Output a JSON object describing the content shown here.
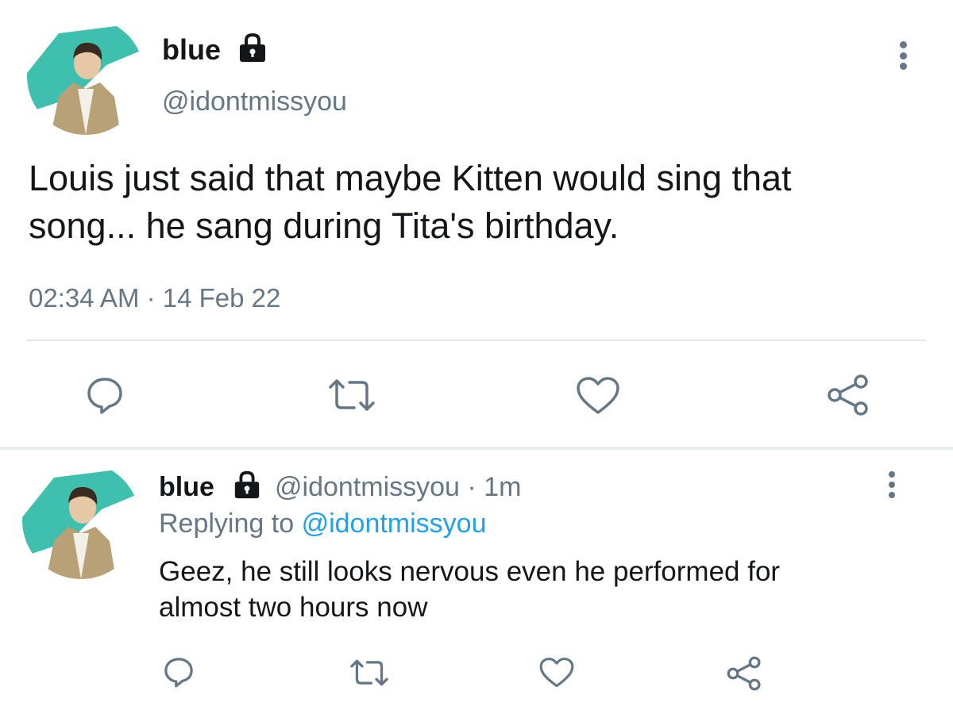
{
  "main_tweet": {
    "display_name": "blue",
    "handle": "@idontmissyou",
    "text_line1": "Louis just said that maybe Kitten would sing that",
    "text_line2": "song... he sang during Tita's birthday.",
    "timestamp": "02:34 AM · 14 Feb 22",
    "actions": [
      "reply-icon",
      "retweet-icon",
      "like-icon",
      "share-icon"
    ]
  },
  "reply_tweet": {
    "display_name": "blue",
    "handle": "@idontmissyou",
    "time": "· 1m",
    "replying_prefix": "Replying to",
    "replying_to": "@idontmissyou",
    "text_line1": "Geez, he still looks nervous even he performed for",
    "text_line2": "almost two hours now",
    "actions": [
      "reply-icon",
      "retweet-icon",
      "like-icon",
      "share-icon"
    ]
  },
  "colors": {
    "text": "#14171a",
    "secondary": "#657786",
    "link": "#1da1f2",
    "avatar_accent": "#3fbfae"
  }
}
